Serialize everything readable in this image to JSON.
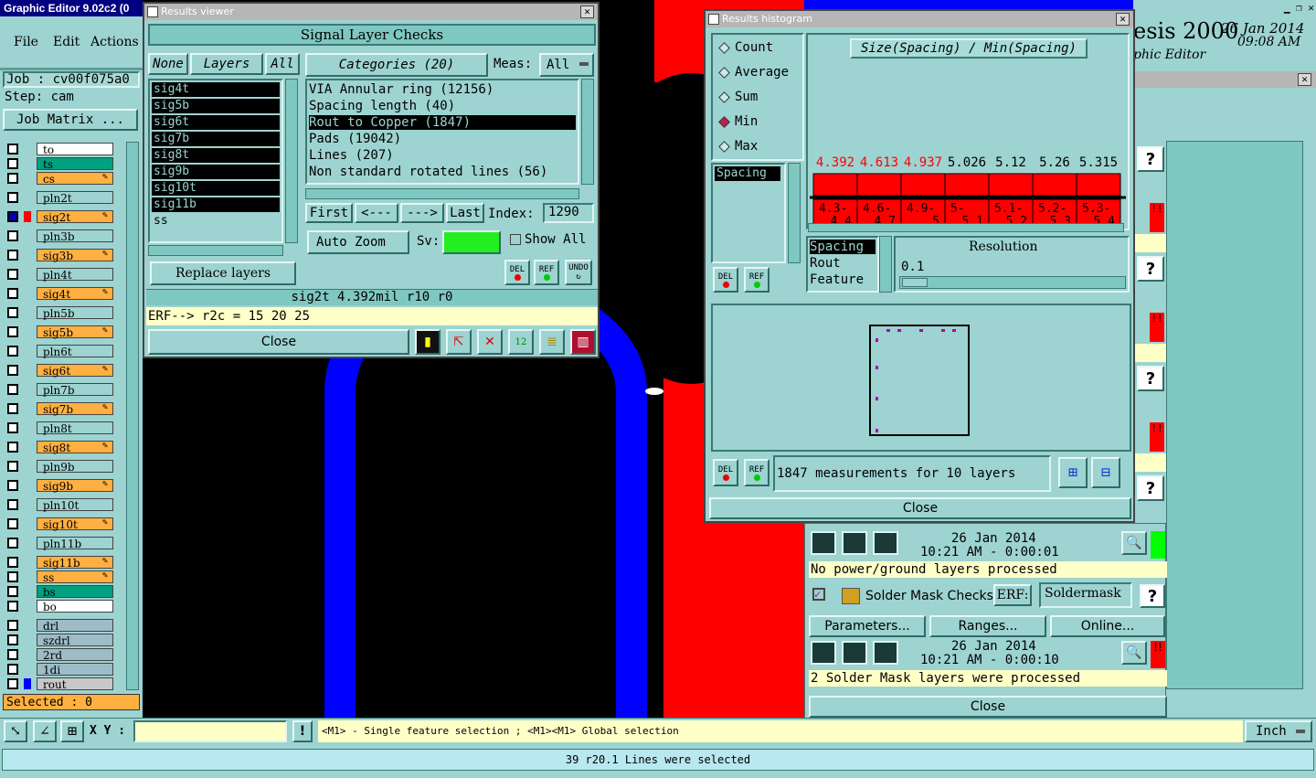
{
  "main_window": {
    "title": "Graphic Editor 9.02c2 (0",
    "menu": [
      "File",
      "Edit",
      "Actions"
    ],
    "job_label": "Job : cv00f075a0",
    "step_label": "Step: cam",
    "job_matrix_btn": "Job Matrix ...",
    "selected_label": "Selected : 0",
    "xy_label": "X Y :",
    "hint": "<M1> - Single feature selection ; <M1><M1> Global selection",
    "unit": "Inch",
    "status": "39 r20.1 Lines were selected"
  },
  "layers": [
    {
      "name": "to",
      "color": "#ffffff"
    },
    {
      "name": "ts",
      "color": "#00a080"
    },
    {
      "name": "cs",
      "color": "#ffb040",
      "flag": true
    },
    {
      "name": "pln2t",
      "color": "#9dd3d0"
    },
    {
      "name": "sig2t",
      "color": "#ffb040",
      "flag": true,
      "active": true
    },
    {
      "name": "pln3b",
      "color": "#9dd3d0"
    },
    {
      "name": "sig3b",
      "color": "#ffb040",
      "flag": true
    },
    {
      "name": "pln4t",
      "color": "#9dd3d0"
    },
    {
      "name": "sig4t",
      "color": "#ffb040",
      "flag": true
    },
    {
      "name": "pln5b",
      "color": "#9dd3d0"
    },
    {
      "name": "sig5b",
      "color": "#ffb040",
      "flag": true
    },
    {
      "name": "pln6t",
      "color": "#9dd3d0"
    },
    {
      "name": "sig6t",
      "color": "#ffb040",
      "flag": true
    },
    {
      "name": "pln7b",
      "color": "#9dd3d0"
    },
    {
      "name": "sig7b",
      "color": "#ffb040",
      "flag": true
    },
    {
      "name": "pln8t",
      "color": "#9dd3d0"
    },
    {
      "name": "sig8t",
      "color": "#ffb040",
      "flag": true
    },
    {
      "name": "pln9b",
      "color": "#9dd3d0"
    },
    {
      "name": "sig9b",
      "color": "#ffb040",
      "flag": true
    },
    {
      "name": "pln10t",
      "color": "#9dd3d0"
    },
    {
      "name": "sig10t",
      "color": "#ffb040",
      "flag": true
    },
    {
      "name": "pln11b",
      "color": "#9dd3d0"
    },
    {
      "name": "sig11b",
      "color": "#ffb040",
      "flag": true
    },
    {
      "name": "ss",
      "color": "#ffb040",
      "flag": true
    },
    {
      "name": "bs",
      "color": "#00a080"
    },
    {
      "name": "bo",
      "color": "#ffffff"
    },
    {
      "name": "drl",
      "color": "#9dbcc8"
    },
    {
      "name": "szdrl",
      "color": "#9dbcc8"
    },
    {
      "name": "2rd",
      "color": "#9dbcc8"
    },
    {
      "name": "1di",
      "color": "#9dbcc8"
    },
    {
      "name": "rout",
      "color": "#c8c8c8"
    }
  ],
  "results_viewer": {
    "title": "Results viewer",
    "header": "Signal Layer Checks",
    "none_btn": "None",
    "layers_btn": "Layers",
    "all_btn": "All",
    "layer_list": [
      "sig4t",
      "sig5b",
      "sig6t",
      "sig7b",
      "sig8t",
      "sig9b",
      "sig10t",
      "sig11b",
      "ss"
    ],
    "categories_btn": "Categories (20)",
    "meas_label": "Meas:",
    "meas_value": "All",
    "categories": [
      "VIA Annular ring (12156)",
      "Spacing length (40)",
      "Rout to Copper (1847)",
      "Pads (19042)",
      "Lines (207)",
      "Non standard rotated lines (56)"
    ],
    "nav": {
      "first": "First",
      "prev": "<---",
      "next": "--->",
      "last": "Last",
      "index_label": "Index:",
      "index_value": "1290"
    },
    "auto_zoom": "Auto Zoom",
    "sv_label": "Sv:",
    "show_all": "Show All",
    "replace_layers": "Replace layers",
    "del": "DEL",
    "ref": "REF",
    "undo": "UNDO",
    "info": "sig2t 4.392mil  r10  r0",
    "erf": "ERF--> r2c = 15 20 25",
    "close": "Close"
  },
  "histogram": {
    "title": "Results histogram",
    "modes": [
      "Count",
      "Average",
      "Sum",
      "Min",
      "Max"
    ],
    "selected_mode": "Min",
    "list_item": "Spacing",
    "chart_title": "Size(Spacing) / Min(Spacing)",
    "types": [
      "Spacing",
      "Rout",
      "Feature"
    ],
    "resolution_label": "Resolution",
    "resolution_value": "0.1",
    "summary": "1847 measurements for 10 layers",
    "close": "Close",
    "del": "DEL",
    "ref": "REF"
  },
  "chart_data": {
    "type": "bar",
    "title": "Size(Spacing) / Min(Spacing)",
    "categories": [
      "4.3-\n4.4",
      "4.6-\n4.7",
      "4.9-\n5",
      "5-\n5.1",
      "5.1-\n5.2",
      "5.2-\n5.3",
      "5.3-\n5.4"
    ],
    "values": [
      4.392,
      4.613,
      4.937,
      5.026,
      5.12,
      5.26,
      5.315
    ],
    "value_labels": [
      "4.392",
      "4.613",
      "4.937",
      "5.026",
      "5.12",
      "5.26",
      "5.315"
    ],
    "highlight_count": 3
  },
  "right_panel": {
    "brand": "esis 2000",
    "brand_sub": "phic Editor",
    "date": "26 Jan 2014",
    "time": "09:08 AM",
    "run1": {
      "date": "26 Jan 2014",
      "time": "10:21 AM - 0:00:01",
      "msg": "No power/ground layers processed"
    },
    "solder": {
      "label": "Solder Mask Checks",
      "erf_label": "ERF:",
      "erf_value": "Soldermask",
      "params": "Parameters...",
      "ranges": "Ranges...",
      "online": "Online..."
    },
    "run2": {
      "date": "26 Jan 2014",
      "time": "10:21 AM - 0:00:10",
      "msg": "2 Solder Mask layers were processed"
    },
    "close": "Close",
    "help": "?"
  },
  "colors": {
    "panel": "#9dd3d0",
    "canvas": "#000000",
    "copper_red": "#ff0000",
    "trace_blue": "#0000ff",
    "accent": "#ff9933"
  }
}
